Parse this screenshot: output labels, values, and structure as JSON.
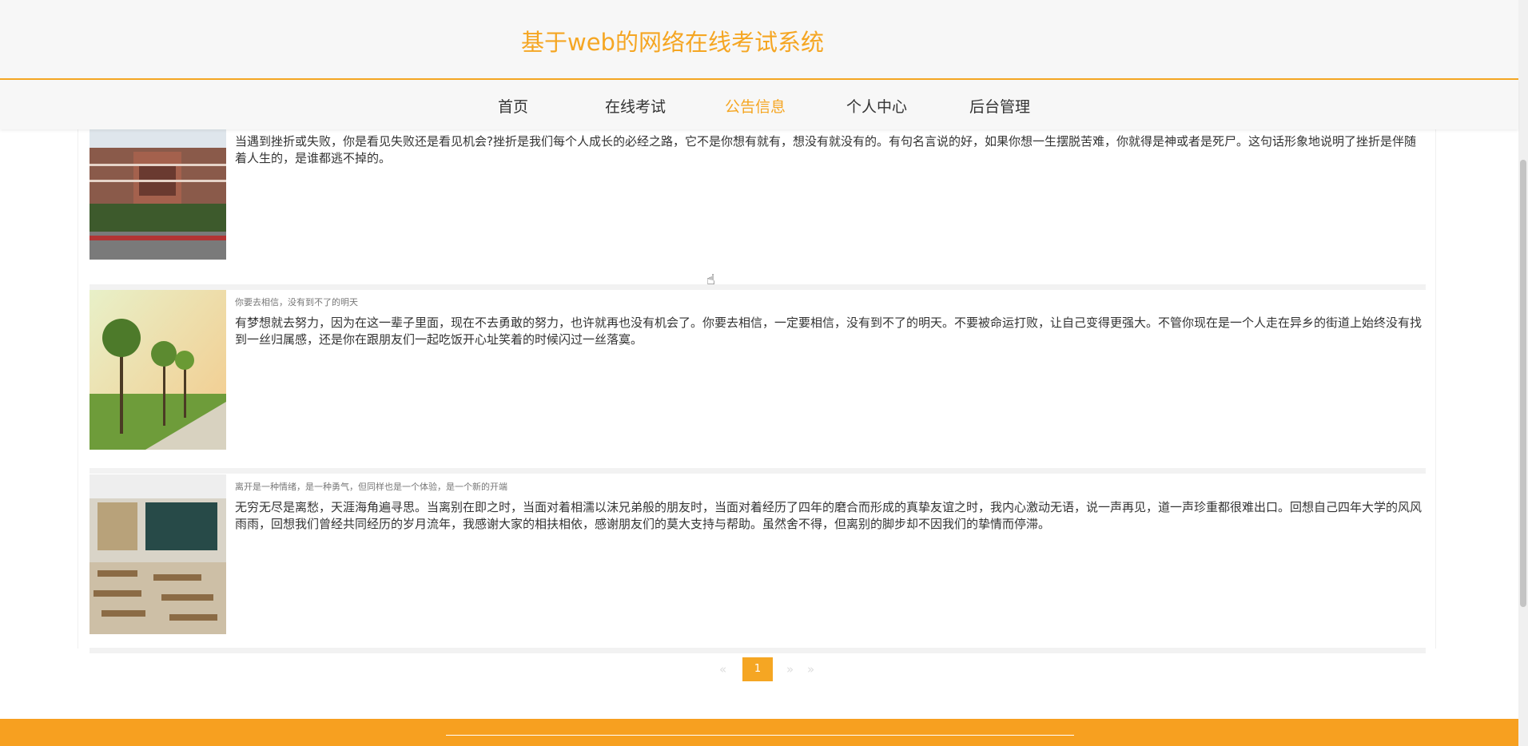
{
  "header": {
    "title": "基于web的网络在线考试系统"
  },
  "nav": {
    "items": [
      {
        "label": "首页"
      },
      {
        "label": "在线考试"
      },
      {
        "label": "公告信息"
      },
      {
        "label": "个人中心"
      },
      {
        "label": "后台管理"
      }
    ],
    "active": "公告信息"
  },
  "notices": [
    {
      "subtitle": "",
      "content": "当遇到挫折或失败，你是看见失败还是看见机会?挫折是我们每个人成长的必经之路，它不是你想有就有，想没有就没有的。有句名言说的好，如果你想一生摆脱苦难，你就得是神或者是死尸。这句话形象地说明了挫折是伴随着人生的，是谁都逃不掉的。",
      "image": "campus-building-photo"
    },
    {
      "subtitle": "你要去相信，没有到不了的明天",
      "content": "有梦想就去努力，因为在这一辈子里面，现在不去勇敢的努力，也许就再也没有机会了。你要去相信，一定要相信，没有到不了的明天。不要被命运打败，让自己变得更强大。不管你现在是一个人走在异乡的街道上始终没有找到一丝归属感，还是你在跟朋友们一起吃饭开心址笑着的时候闪过一丝落寞。",
      "image": "tree-lined-path-photo"
    },
    {
      "subtitle": "离开是一种情绪，是一种勇气，但同样也是一个体验，是一个新的开端",
      "content": "无穷无尽是离愁，天涯海角遍寻思。当离别在即之时，当面对着相濡以沫兄弟般的朋友时，当面对着经历了四年的磨合而形成的真挚友谊之时，我内心激动无语，说一声再见，道一声珍重都很难出口。回想自己四年大学的风风雨雨，回想我们曾经共同经历的岁月流年，我感谢大家的相扶相依，感谢朋友们的莫大支持与帮助。虽然舍不得，但离别的脚步却不因我们的挚情而停滞。",
      "image": "classroom-photo"
    }
  ],
  "pagination": {
    "prev": "«",
    "current": "1",
    "next": "»",
    "last": "»"
  },
  "colors": {
    "accent": "#f5a623",
    "footer": "#f7a020"
  }
}
